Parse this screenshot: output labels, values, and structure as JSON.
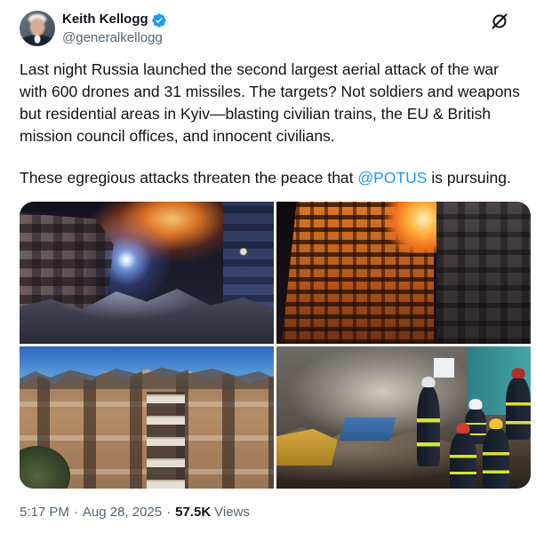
{
  "colors": {
    "text": "#0f1419",
    "secondary": "#536471",
    "accent": "#1d9bf0",
    "background": "#ffffff"
  },
  "author": {
    "name": "Keith Kellogg",
    "handle": "@generalkellogg",
    "verified": true
  },
  "icons": {
    "verified": "verified-badge-icon",
    "header_action": "grok-icon"
  },
  "tweet": {
    "paragraph_1": "Last night Russia launched the second largest aerial attack of the war with 600 drones and 31 missiles. The targets? Not soldiers and weapons but residential areas in Kyiv—blasting civilian trains, the EU & British mission council offices, and innocent civilians.",
    "paragraph_2": {
      "before": "These egregious attacks threaten the peace that ",
      "mention": "@POTUS",
      "after": " is pursuing."
    }
  },
  "footer": {
    "time": "5:17 PM",
    "separator": "·",
    "date": "Aug 28, 2025",
    "views_count": "57.5K",
    "views_label": "Views"
  }
}
